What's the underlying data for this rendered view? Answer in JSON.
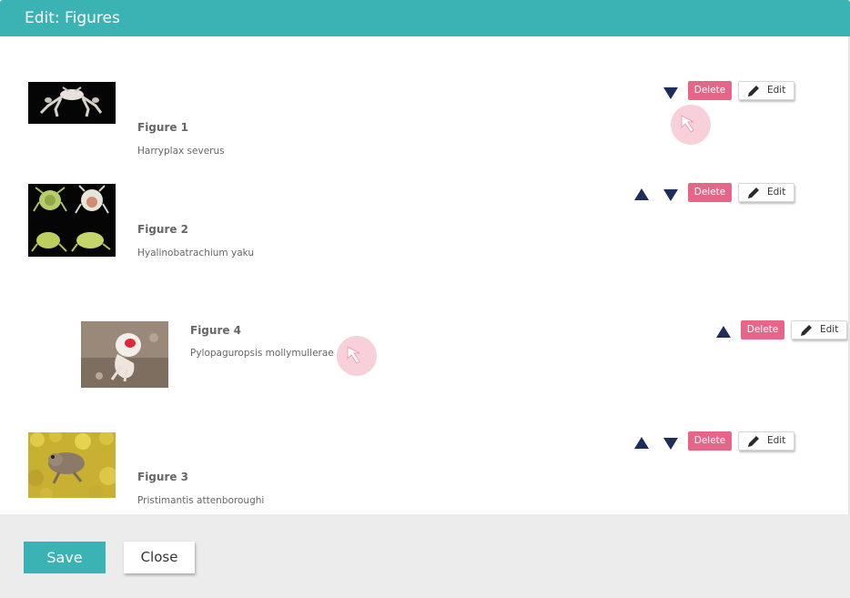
{
  "dialog": {
    "title": "Edit: Figures"
  },
  "figures": [
    {
      "title": "Figure 1",
      "caption": "Harryplax severus",
      "can_move_up": false,
      "can_move_down": true
    },
    {
      "title": "Figure 2",
      "caption": "Hyalinobatrachium yaku",
      "can_move_up": true,
      "can_move_down": true
    },
    {
      "title": "Figure 4",
      "caption": "Pylopaguropsis mollymullerae",
      "can_move_up": true,
      "can_move_down": false,
      "dragging": true
    },
    {
      "title": "Figure 3",
      "caption": "Pristimantis attenboroughi",
      "can_move_up": true,
      "can_move_down": true
    }
  ],
  "labels": {
    "delete": "Delete",
    "edit": "Edit"
  },
  "footer": {
    "save_label": "Save",
    "close_label": "Close"
  },
  "colors": {
    "accent": "#3bb2b4",
    "delete": "#e8658a",
    "arrow": "#1f2d5a",
    "footer_bg": "#ececec"
  },
  "icons": {
    "move_up": "triangle-up-icon",
    "move_down": "triangle-down-icon",
    "edit": "pencil-icon",
    "cursor": "cursor-arrow-icon"
  }
}
